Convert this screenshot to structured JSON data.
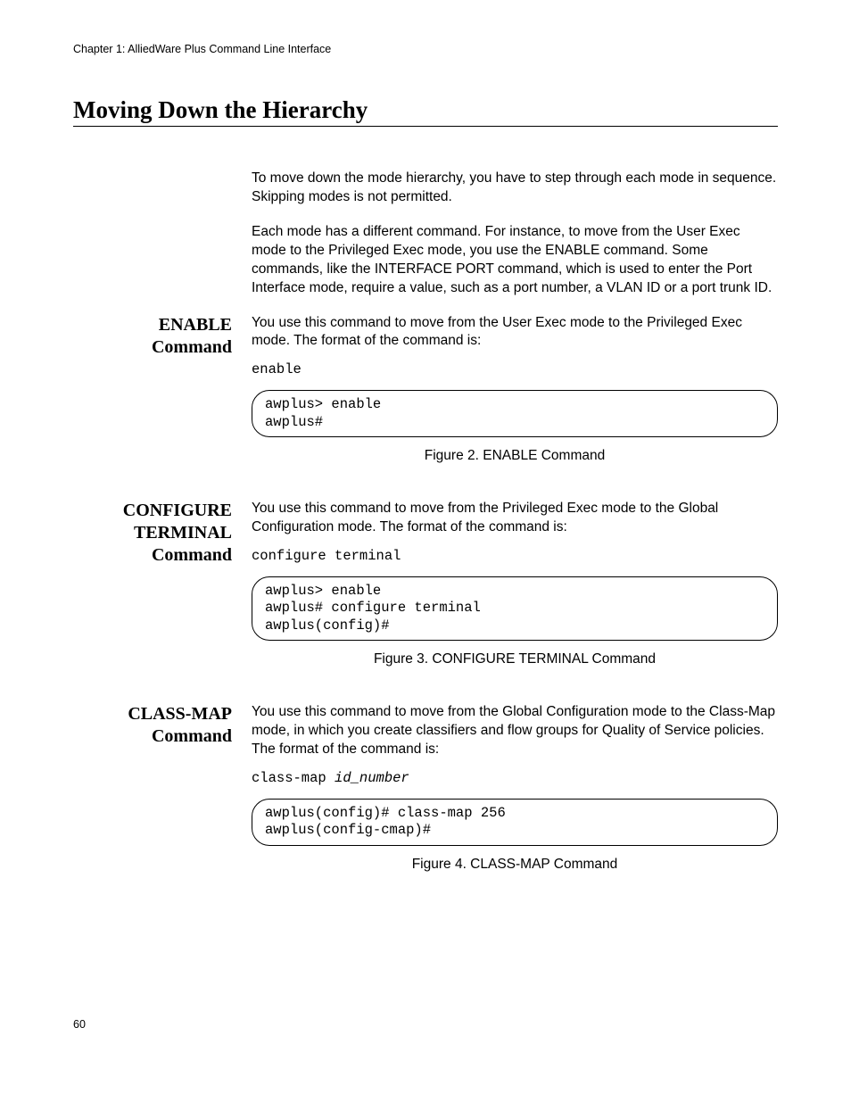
{
  "chapter_header": "Chapter 1: AlliedWare Plus Command Line Interface",
  "section_title": "Moving Down the Hierarchy",
  "intro": {
    "p1": "To move down the mode hierarchy, you have to step through each mode in sequence. Skipping modes is not permitted.",
    "p2": "Each mode has a different command. For instance, to move from the User Exec mode to the Privileged Exec mode, you use the ENABLE command. Some commands, like the INTERFACE PORT command, which is used to enter the Port Interface mode, require a value, such as a port number, a VLAN ID or a port trunk ID."
  },
  "enable": {
    "heading_l1": "ENABLE",
    "heading_l2": "Command",
    "para": "You use this command to move from the User Exec mode to the Privileged Exec mode. The format of the command is:",
    "cmd": "enable",
    "terminal": "awplus> enable\nawplus#",
    "caption": "Figure 2. ENABLE Command"
  },
  "config_term": {
    "heading_l1": "CONFIGURE",
    "heading_l2": "TERMINAL",
    "heading_l3": "Command",
    "para": "You use this command to move from the Privileged Exec mode to the Global Configuration mode. The format of the command is:",
    "cmd": "configure terminal",
    "terminal": "awplus> enable\nawplus# configure terminal\nawplus(config)#",
    "caption": "Figure 3. CONFIGURE TERMINAL Command"
  },
  "class_map": {
    "heading_l1": "CLASS-MAP",
    "heading_l2": "Command",
    "para": "You use this command to move from the Global Configuration mode to the Class-Map mode, in which you create classifiers and flow groups for Quality of Service policies. The format of the command is:",
    "cmd_prefix": "class-map ",
    "cmd_arg": "id_number",
    "terminal": "awplus(config)# class-map 256\nawplus(config-cmap)#",
    "caption": "Figure 4. CLASS-MAP Command"
  },
  "page_number": "60"
}
